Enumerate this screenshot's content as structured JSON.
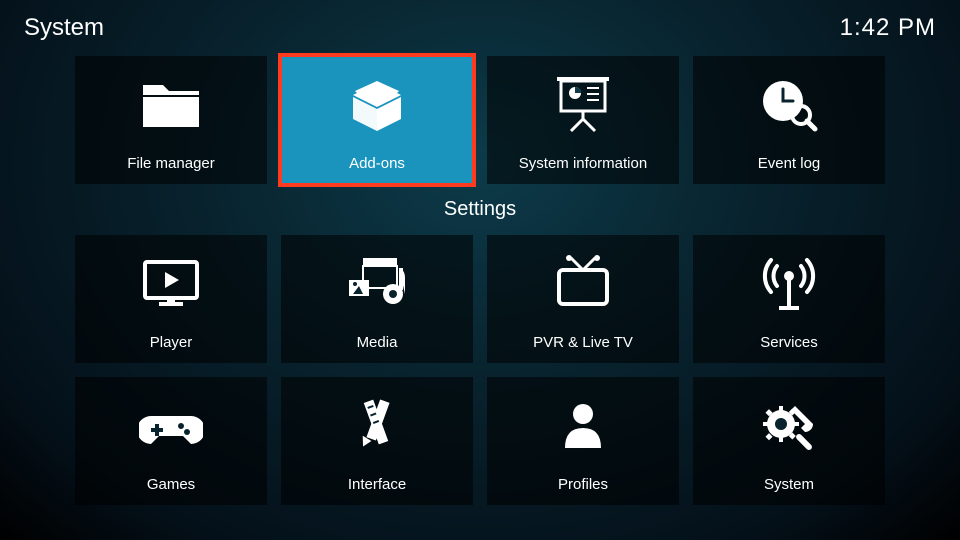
{
  "header": {
    "title": "System",
    "clock": "1:42 PM"
  },
  "section_label": "Settings",
  "row1": [
    {
      "label": "File manager",
      "icon": "folder-icon",
      "selected": false
    },
    {
      "label": "Add-ons",
      "icon": "box-icon",
      "selected": true
    },
    {
      "label": "System information",
      "icon": "presentation-icon",
      "selected": false
    },
    {
      "label": "Event log",
      "icon": "clock-search-icon",
      "selected": false
    }
  ],
  "row2": [
    {
      "label": "Player",
      "icon": "monitor-play-icon",
      "selected": false
    },
    {
      "label": "Media",
      "icon": "media-library-icon",
      "selected": false
    },
    {
      "label": "PVR & Live TV",
      "icon": "tv-icon",
      "selected": false
    },
    {
      "label": "Services",
      "icon": "antenna-icon",
      "selected": false
    }
  ],
  "row3": [
    {
      "label": "Games",
      "icon": "gamepad-icon",
      "selected": false
    },
    {
      "label": "Interface",
      "icon": "pencil-ruler-icon",
      "selected": false
    },
    {
      "label": "Profiles",
      "icon": "user-icon",
      "selected": false
    },
    {
      "label": "System",
      "icon": "gear-wrench-icon",
      "selected": false
    }
  ]
}
